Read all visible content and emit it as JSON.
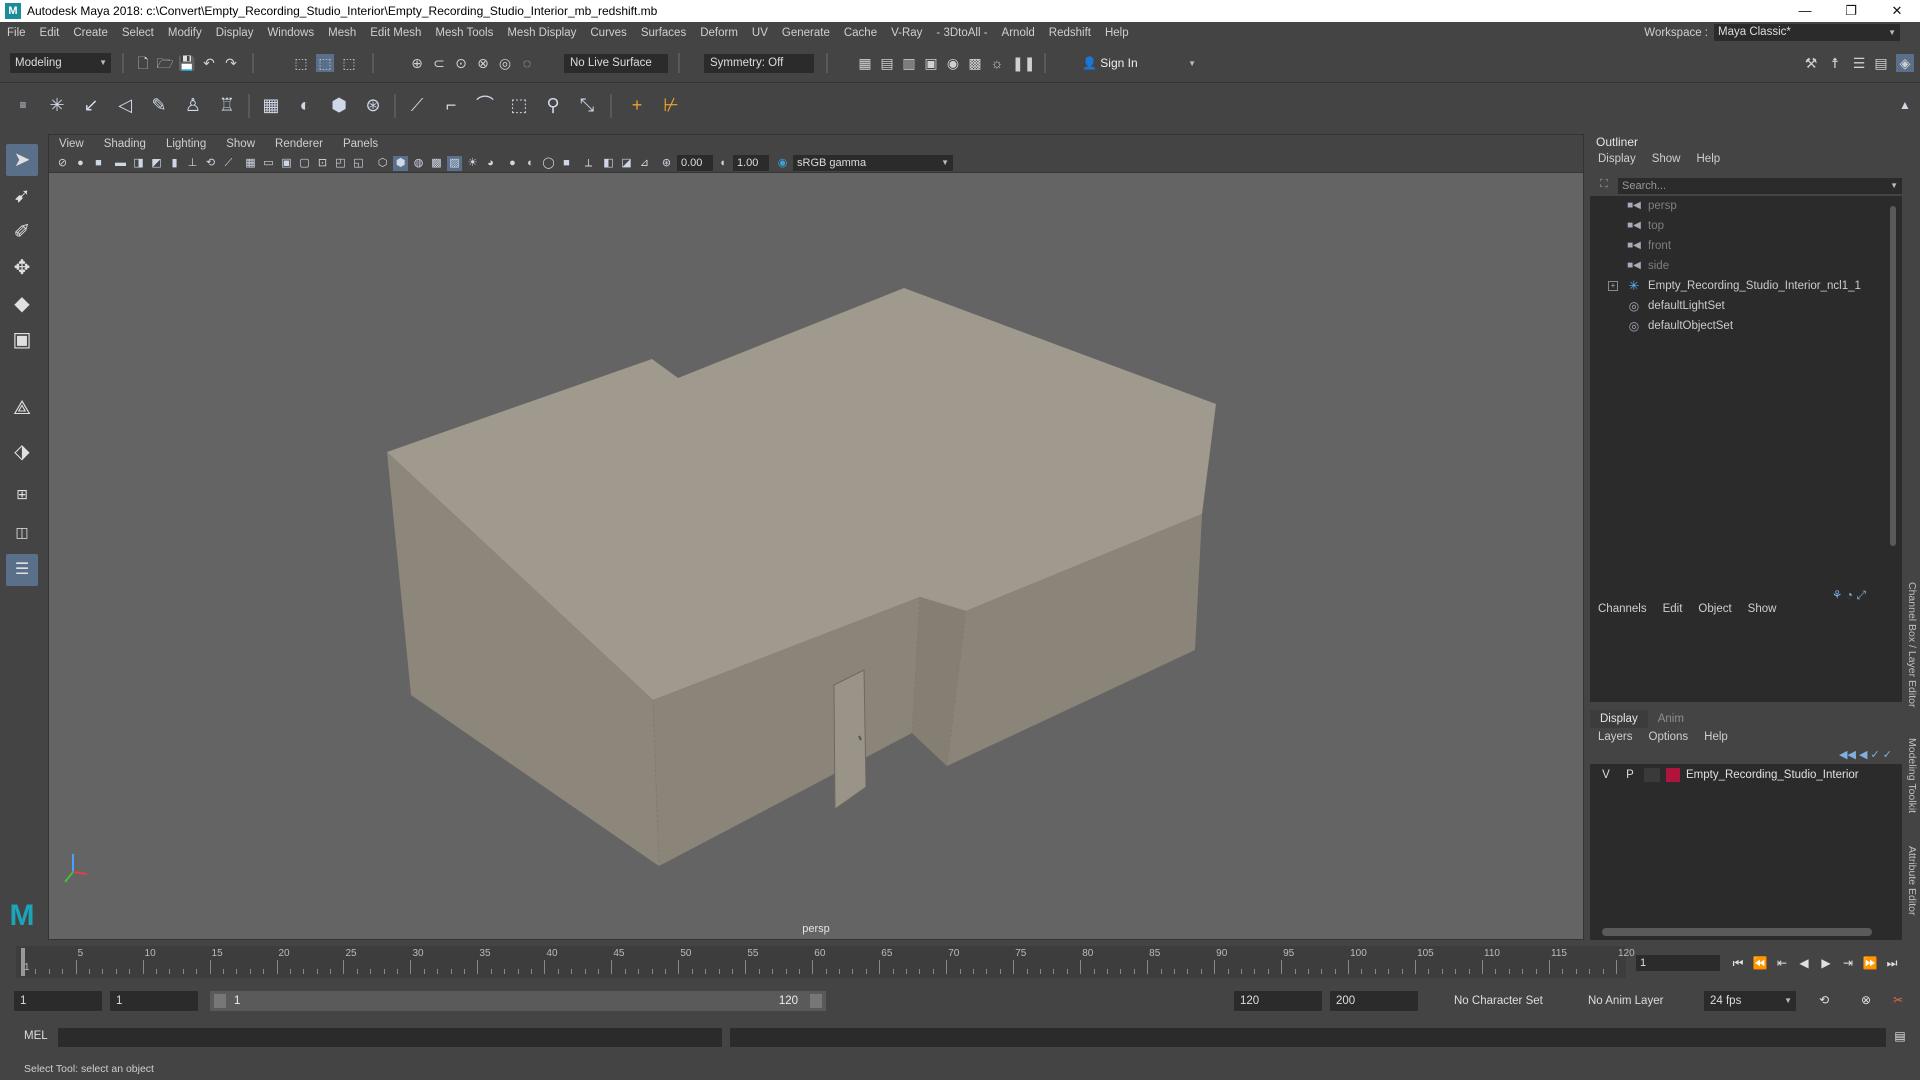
{
  "window": {
    "title": "Autodesk Maya 2018: c:\\Convert\\Empty_Recording_Studio_Interior\\Empty_Recording_Studio_Interior_mb_redshift.mb",
    "minimize": "—",
    "maximize": "❐",
    "close": "✕"
  },
  "menubar": {
    "items": [
      "File",
      "Edit",
      "Create",
      "Select",
      "Modify",
      "Display",
      "Windows",
      "Mesh",
      "Edit Mesh",
      "Mesh Tools",
      "Mesh Display",
      "Curves",
      "Surfaces",
      "Deform",
      "UV",
      "Generate",
      "Cache",
      "V-Ray",
      "- 3DtoAll -",
      "Arnold",
      "Redshift",
      "Help"
    ],
    "workspace_label": "Workspace :",
    "workspace_value": "Maya Classic*"
  },
  "statusline": {
    "mode": "Modeling",
    "live_surface": "No Live Surface",
    "symmetry": "Symmetry: Off",
    "sign_in": "Sign In"
  },
  "panel": {
    "menu": [
      "View",
      "Shading",
      "Lighting",
      "Show",
      "Renderer",
      "Panels"
    ],
    "exposure": "0.00",
    "gamma": "1.00",
    "color_space": "sRGB gamma",
    "camera_label": "persp"
  },
  "outliner": {
    "title": "Outliner",
    "menu": [
      "Display",
      "Show",
      "Help"
    ],
    "search_placeholder": "Search...",
    "items": [
      {
        "label": "persp",
        "icon": "camera-icon",
        "dim": true
      },
      {
        "label": "top",
        "icon": "camera-icon",
        "dim": true
      },
      {
        "label": "front",
        "icon": "camera-icon",
        "dim": true
      },
      {
        "label": "side",
        "icon": "camera-icon",
        "dim": true
      },
      {
        "label": "Empty_Recording_Studio_Interior_ncl1_1",
        "icon": "group-icon",
        "dim": false,
        "expandable": true
      },
      {
        "label": "defaultLightSet",
        "icon": "set-icon",
        "dim": false
      },
      {
        "label": "defaultObjectSet",
        "icon": "set-icon",
        "dim": false
      }
    ]
  },
  "channelbox": {
    "menu": [
      "Channels",
      "Edit",
      "Object",
      "Show"
    ]
  },
  "layers": {
    "tabs": [
      "Display",
      "Anim"
    ],
    "active_tab": "Display",
    "menu": [
      "Layers",
      "Options",
      "Help"
    ],
    "rows": [
      {
        "visible": "V",
        "playback": "P",
        "color": "#b0143c",
        "name": "Empty_Recording_Studio_Interior"
      }
    ]
  },
  "side_tabs": [
    "Channel Box / Layer Editor",
    "Modeling Toolkit",
    "Attribute Editor"
  ],
  "timeslider": {
    "ticks": [
      5,
      10,
      15,
      20,
      25,
      30,
      35,
      40,
      45,
      50,
      55,
      60,
      65,
      70,
      75,
      80,
      85,
      90,
      95,
      100,
      105,
      110,
      115,
      120
    ],
    "first_frame_label": "1",
    "current_frame": "1",
    "max_frame": 120
  },
  "rangeslider": {
    "start": "1",
    "playback_start": "1",
    "range_start": "1",
    "range_end": "120",
    "playback_end": "120",
    "end": "200",
    "character_set": "No Character Set",
    "anim_layer": "No Anim Layer",
    "fps": "24 fps"
  },
  "cmdline": {
    "label": "MEL"
  },
  "helpline": {
    "text": "Select Tool: select an object"
  },
  "colors": {
    "viewport_bg": "#646464",
    "model_top": "#a0998d",
    "model_side": "#8b8479",
    "accent": "#5a6f8a"
  }
}
